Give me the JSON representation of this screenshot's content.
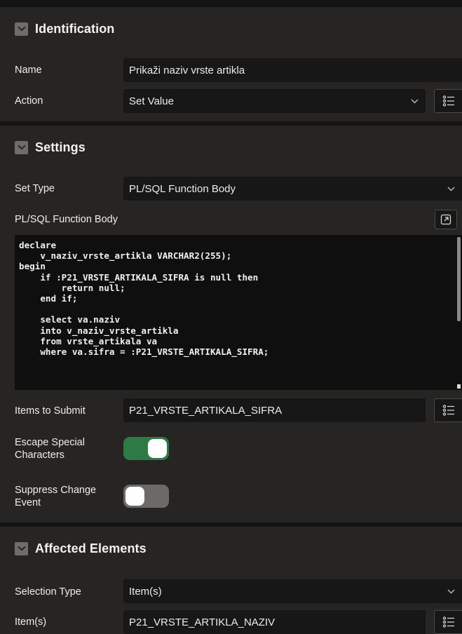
{
  "identification": {
    "title": "Identification",
    "name_label": "Name",
    "name_value": "Prikaži naziv vrste artikla",
    "action_label": "Action",
    "action_value": "Set Value"
  },
  "settings": {
    "title": "Settings",
    "set_type_label": "Set Type",
    "set_type_value": "PL/SQL Function Body",
    "body_label": "PL/SQL Function Body",
    "code_lines": [
      "declare",
      "    v_naziv_vrste_artikla VARCHAR2(255);",
      "begin",
      "    if :P21_VRSTE_ARTIKALA_SIFRA is null then",
      "        return null;",
      "    end if;",
      "",
      "    select va.naziv",
      "    into v_naziv_vrste_artikla",
      "    from vrste_artikala va",
      "    where va.sifra = :P21_VRSTE_ARTIKALA_SIFRA;"
    ],
    "items_submit_label": "Items to Submit",
    "items_submit_value": "P21_VRSTE_ARTIKALA_SIFRA",
    "escape_label": "Escape Special Characters",
    "escape_on": true,
    "suppress_label": "Suppress Change Event",
    "suppress_on": false
  },
  "affected": {
    "title": "Affected Elements",
    "selection_type_label": "Selection Type",
    "selection_type_value": "Item(s)",
    "items_label": "Item(s)",
    "items_value": "P21_VRSTE_ARTIKLA_NAZIV"
  },
  "colors": {
    "toggle_on": "#2d7a46",
    "toggle_off": "#6b6a67"
  }
}
